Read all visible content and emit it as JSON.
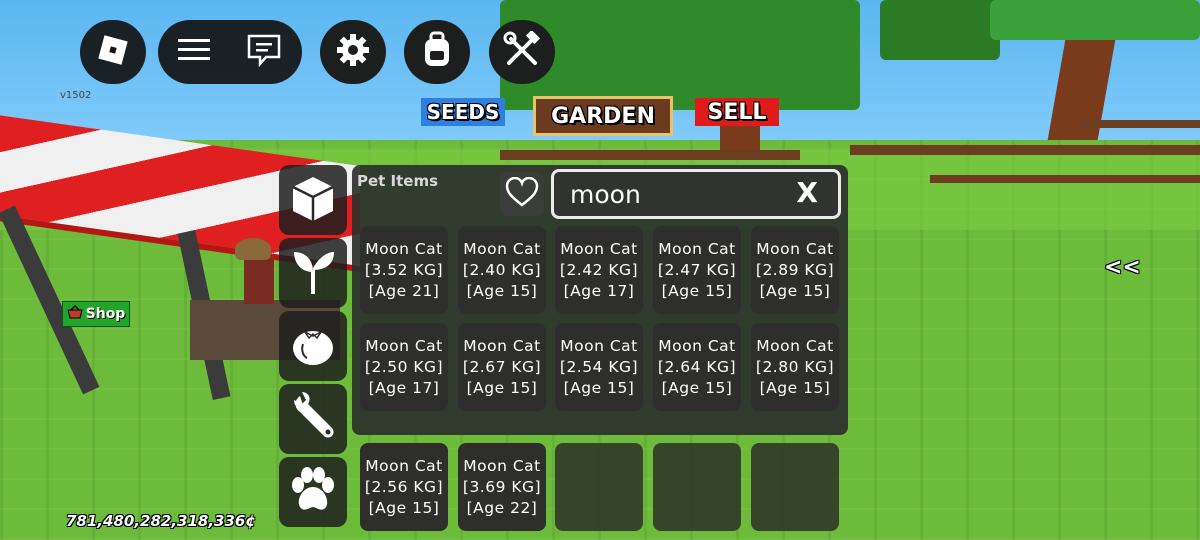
{
  "version": "v1502",
  "tabs": {
    "seeds": "SEEDS",
    "garden": "GARDEN",
    "sell": "SELL"
  },
  "shop_label": "Shop",
  "panel": {
    "title": "Pet Items",
    "search_value": "moon",
    "clear_label": "X"
  },
  "items": [
    {
      "name": "Moon Cat",
      "weight": "[3.52 KG]",
      "age": "[Age 21]"
    },
    {
      "name": "Moon Cat",
      "weight": "[2.40 KG]",
      "age": "[Age 15]"
    },
    {
      "name": "Moon Cat",
      "weight": "[2.42 KG]",
      "age": "[Age 17]"
    },
    {
      "name": "Moon Cat",
      "weight": "[2.47 KG]",
      "age": "[Age 15]"
    },
    {
      "name": "Moon Cat",
      "weight": "[2.89 KG]",
      "age": "[Age 15]"
    },
    {
      "name": "Moon Cat",
      "weight": "[2.50 KG]",
      "age": "[Age 17]"
    },
    {
      "name": "Moon Cat",
      "weight": "[2.67 KG]",
      "age": "[Age 15]"
    },
    {
      "name": "Moon Cat",
      "weight": "[2.54 KG]",
      "age": "[Age 15]"
    },
    {
      "name": "Moon Cat",
      "weight": "[2.64 KG]",
      "age": "[Age 15]"
    },
    {
      "name": "Moon Cat",
      "weight": "[2.80 KG]",
      "age": "[Age 15]"
    },
    {
      "name": "Moon Cat",
      "weight": "[2.56 KG]",
      "age": "[Age 15]"
    },
    {
      "name": "Moon Cat",
      "weight": "[3.69 KG]",
      "age": "[Age 22]"
    }
  ],
  "money": "781,480,282,318,336¢",
  "collapse_label": "<<",
  "icons": [
    "roblox-logo-icon",
    "menu-icon",
    "chat-icon",
    "gear-icon",
    "backpack-icon",
    "tools-icon",
    "box-icon",
    "sprout-icon",
    "tomato-icon",
    "wrench-icon",
    "paw-icon",
    "heart-icon",
    "basket-icon"
  ]
}
